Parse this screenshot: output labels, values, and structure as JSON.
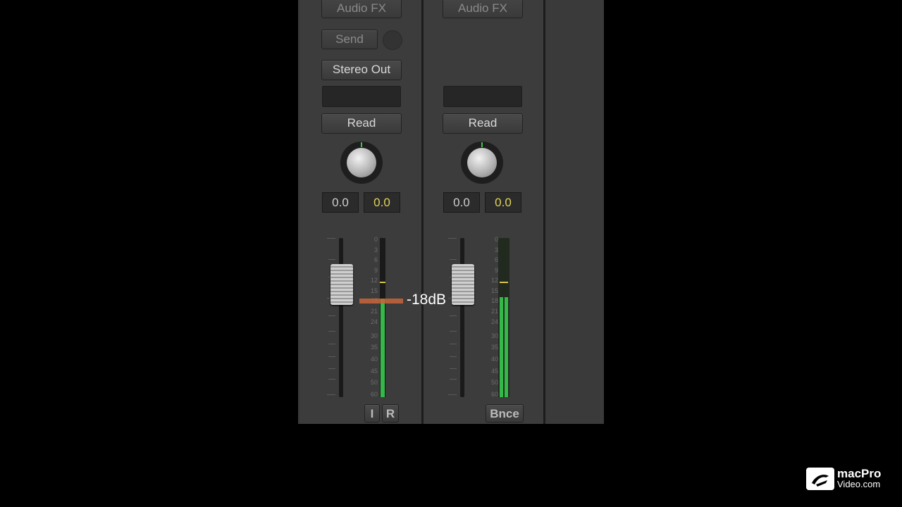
{
  "strips": [
    {
      "audio_fx": "Audio FX",
      "send": "Send",
      "output": "Stereo Out",
      "automation": "Read",
      "values": [
        "0.0",
        "0.0"
      ],
      "buttons": [
        "I",
        "R"
      ]
    },
    {
      "audio_fx": "Audio FX",
      "automation": "Read",
      "values": [
        "0.0",
        "0.0"
      ],
      "buttons": [
        "Bnce"
      ]
    }
  ],
  "meter_scale": [
    "0",
    "3",
    "6",
    "9",
    "12",
    "15",
    "18",
    "21",
    "24",
    "30",
    "35",
    "40",
    "45",
    "50",
    "60"
  ],
  "annotation": {
    "label": "-18dB"
  },
  "meters": {
    "strip1_level_db": -18,
    "strip2_level_db": -18
  },
  "logo": {
    "text_top": "macPro",
    "text_bottom": "Video.com"
  },
  "colors": {
    "accent_yellow": "#e1d35a",
    "meter_green": "#35b84a",
    "annotation_bar": "#c8643a"
  }
}
